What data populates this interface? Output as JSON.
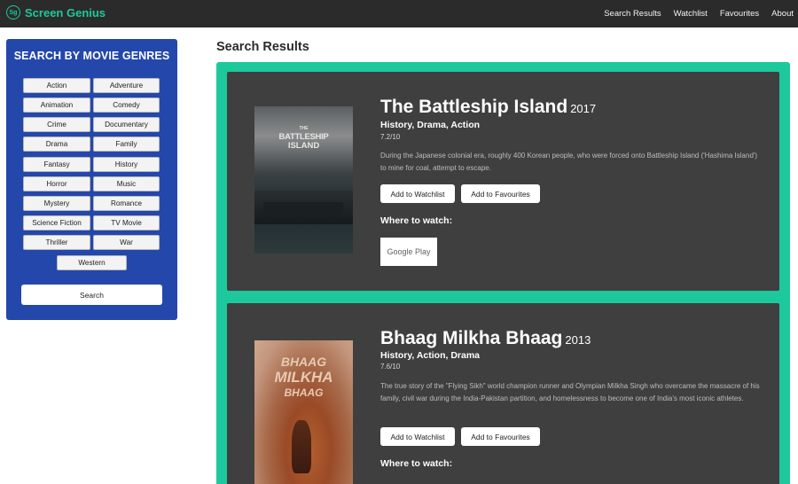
{
  "navbar": {
    "logo_text": "Sg",
    "brand": "Screen Genius",
    "links": [
      "Search Results",
      "Watchlist",
      "Favourites",
      "About"
    ]
  },
  "sidebar": {
    "title": "SEARCH BY MOVIE GENRES",
    "genres": [
      "Action",
      "Adventure",
      "Animation",
      "Comedy",
      "Crime",
      "Documentary",
      "Drama",
      "Family",
      "Fantasy",
      "History",
      "Horror",
      "Music",
      "Mystery",
      "Romance",
      "Science Fiction",
      "TV Movie",
      "Thriller",
      "War",
      "Western"
    ],
    "search_label": "Search"
  },
  "results": {
    "title": "Search Results",
    "movies": [
      {
        "title": "The Battleship Island",
        "year": "2017",
        "genres": "History, Drama, Action",
        "rating": "7.2/10",
        "description": "During the Japanese colonial era, roughly 400 Korean people, who were forced onto Battleship Island ('Hashima Island') to mine for coal, attempt to escape.",
        "watchlist_label": "Add to Watchlist",
        "favourites_label": "Add to Favourites",
        "where_label": "Where to watch:",
        "provider": "Google Play",
        "poster_text": [
          "THE",
          "BATTLESHIP",
          "ISLAND"
        ]
      },
      {
        "title": "Bhaag Milkha Bhaag",
        "year": "2013",
        "genres": "History, Action, Drama",
        "rating": "7.6/10",
        "description": "The true story of the \"Flying Sikh\" world champion runner and Olympian Milkha Singh who overcame the massacre of his family, civil war during the India-Pakistan partition, and homelessness to become one of India's most iconic athletes.",
        "watchlist_label": "Add to Watchlist",
        "favourites_label": "Add to Favourites",
        "where_label": "Where to watch:",
        "poster_text": [
          "BHAAG",
          "MILKHA",
          "BHAAG"
        ]
      }
    ]
  }
}
